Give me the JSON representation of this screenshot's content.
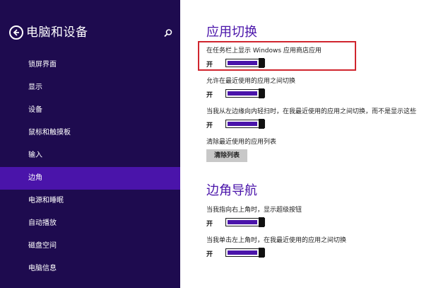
{
  "sidebar": {
    "title": "电脑和设备",
    "items": [
      {
        "label": "锁屏界面"
      },
      {
        "label": "显示"
      },
      {
        "label": "设备"
      },
      {
        "label": "鼠标和触摸板"
      },
      {
        "label": "输入"
      },
      {
        "label": "边角"
      },
      {
        "label": "电源和睡眠"
      },
      {
        "label": "自动播放"
      },
      {
        "label": "磁盘空间"
      },
      {
        "label": "电脑信息"
      }
    ],
    "active_item": "边角"
  },
  "main": {
    "sections": [
      {
        "title": "应用切换",
        "settings": [
          {
            "label": "在任务栏上显示 Windows 应用商店应用",
            "state": "开"
          },
          {
            "label": "允许在最近使用的应用之间切换",
            "state": "开"
          },
          {
            "label": "当我从左边缘向内轻扫时，在我最近使用的应用之间切换，而不是显示这些",
            "state": "开"
          },
          {
            "label": "清除最近使用的应用列表",
            "button": "清除列表"
          }
        ]
      },
      {
        "title": "边角导航",
        "settings": [
          {
            "label": "当我指向右上角时，显示超级按钮",
            "state": "开"
          },
          {
            "label": "当我单击左上角时，在我最近使用的应用之间切换",
            "state": "开"
          }
        ]
      }
    ]
  },
  "colors": {
    "sidebar_bg": "#1e0b4f",
    "accent": "#4a14aa",
    "highlight_box": "#d0252e"
  }
}
